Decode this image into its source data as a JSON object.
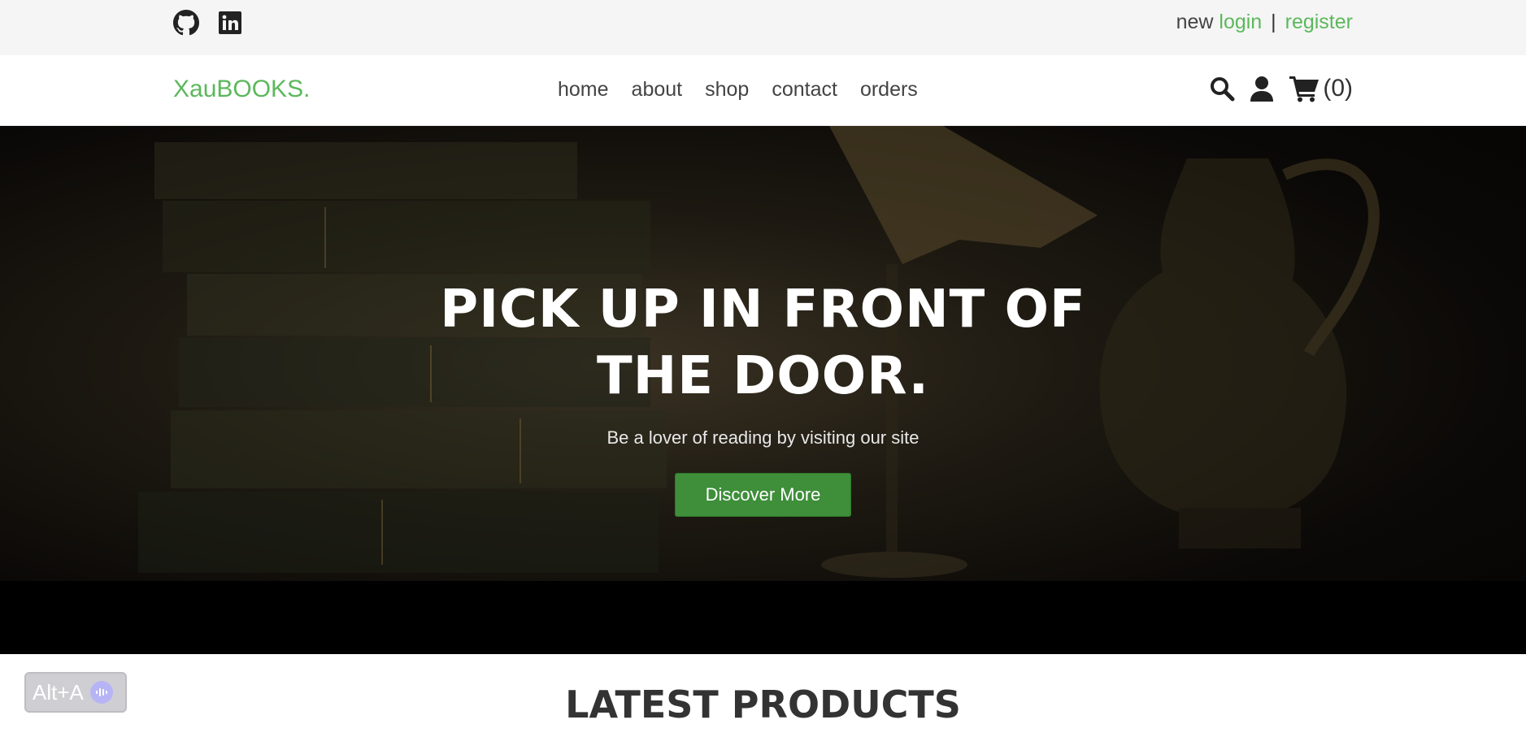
{
  "topbar": {
    "social": [
      {
        "icon": "github-icon"
      },
      {
        "icon": "linkedin-icon"
      }
    ],
    "new_text": "new",
    "login_label": "login",
    "separator": "|",
    "register_label": "register"
  },
  "header": {
    "logo": "XauBOOKS.",
    "nav": [
      "home",
      "about",
      "shop",
      "contact",
      "orders"
    ],
    "icons": [
      "search-icon",
      "user-icon",
      "cart-icon"
    ],
    "cart_count": "(0)"
  },
  "hero": {
    "title_line1": "PICK UP IN FRONT OF",
    "title_line2": "THE DOOR.",
    "subtitle": "Be a lover of reading by visiting our site",
    "cta_label": "Discover More"
  },
  "latest": {
    "heading": "LATEST PRODUCTS"
  },
  "widget": {
    "label": "Alt+A"
  },
  "colors": {
    "accent": "#5cb85c",
    "button": "#3e8e3a",
    "topbar_bg": "#f5f5f5"
  }
}
